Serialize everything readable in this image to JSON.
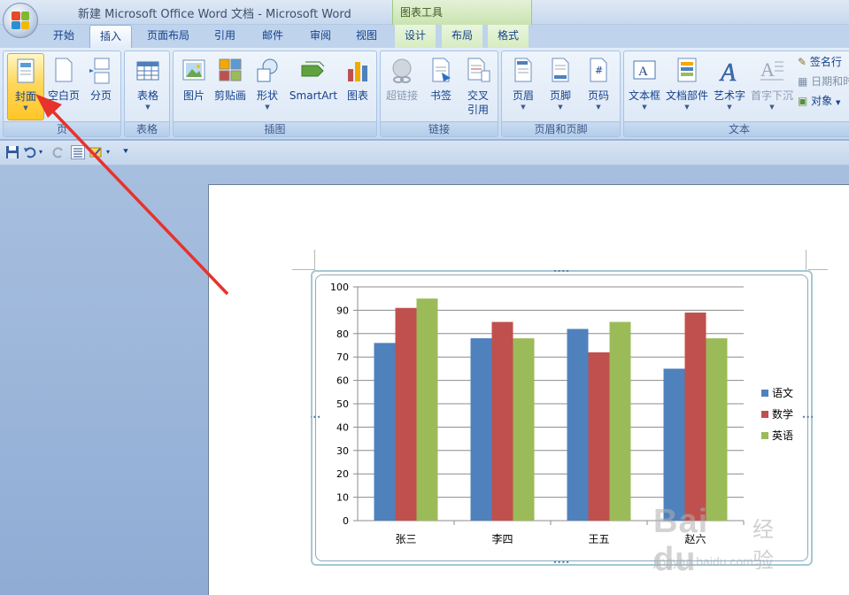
{
  "window": {
    "title": "新建 Microsoft Office Word 文档 - Microsoft Word",
    "context_tools": "图表工具"
  },
  "tabs": [
    {
      "label": "开始",
      "active": false
    },
    {
      "label": "插入",
      "active": true
    },
    {
      "label": "页面布局",
      "active": false
    },
    {
      "label": "引用",
      "active": false
    },
    {
      "label": "邮件",
      "active": false
    },
    {
      "label": "审阅",
      "active": false
    },
    {
      "label": "视图",
      "active": false
    },
    {
      "label": "设计",
      "active": false
    },
    {
      "label": "布局",
      "active": false
    },
    {
      "label": "格式",
      "active": false
    }
  ],
  "ribbon": {
    "pages_group": {
      "label": "页",
      "cover": "封面",
      "blank": "空白页",
      "break": "分页"
    },
    "table_group": {
      "label": "表格",
      "table": "表格"
    },
    "illus_group": {
      "label": "插图",
      "picture": "图片",
      "clipart": "剪贴画",
      "shapes": "形状",
      "smartart": "SmartArt",
      "chart": "图表"
    },
    "links_group": {
      "label": "链接",
      "hyperlink": "超链接",
      "bookmark": "书签",
      "crossref1": "交叉",
      "crossref2": "引用"
    },
    "hf_group": {
      "label": "页眉和页脚",
      "header": "页眉",
      "footer": "页脚",
      "pagenum": "页码"
    },
    "text_group": {
      "label": "文本",
      "textbox": "文本框",
      "quickparts": "文档部件",
      "wordart": "艺术字",
      "dropcap": "首字下沉",
      "signature": "签名行",
      "datetime": "日期和时",
      "object": "对象"
    }
  },
  "colors": {
    "series1": "#4f81bd",
    "series2": "#c0504d",
    "series3": "#9bbb59",
    "arrow": "#e8322c"
  },
  "chart_data": {
    "type": "bar",
    "categories": [
      "张三",
      "李四",
      "王五",
      "赵六"
    ],
    "series": [
      {
        "name": "语文",
        "values": [
          76,
          78,
          82,
          65
        ]
      },
      {
        "name": "数学",
        "values": [
          91,
          85,
          72,
          89
        ]
      },
      {
        "name": "英语",
        "values": [
          95,
          78,
          85,
          78
        ]
      }
    ],
    "yticks": [
      "0",
      "10",
      "20",
      "30",
      "40",
      "50",
      "60",
      "70",
      "80",
      "90",
      "100"
    ],
    "ylim": [
      0,
      100
    ],
    "grid": true,
    "legend": "right"
  },
  "watermark": {
    "logo": "Bai du",
    "cn": "经验",
    "url": "jingyan.baidu.com"
  }
}
